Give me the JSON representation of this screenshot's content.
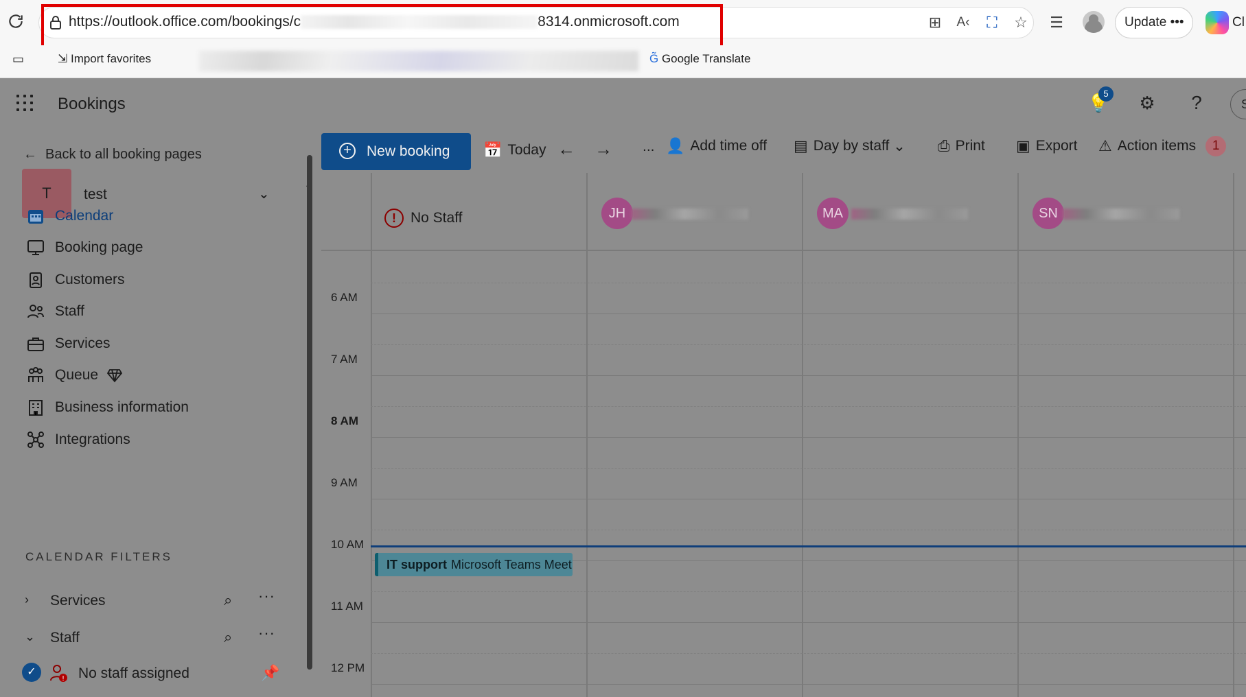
{
  "browser": {
    "url_prefix": "https://outlook.office.com/bookings/c",
    "url_suffix": "8314.onmicrosoft.com",
    "update_label": "Update",
    "update_more": "•••",
    "copilot_label": "Cl",
    "favorites": [
      {
        "label": "Import favorites"
      },
      {
        "label": "Google Translate"
      }
    ]
  },
  "app": {
    "title": "Bookings",
    "notification_count": "5",
    "user_initial": "S"
  },
  "sidebar": {
    "back_label": "Back to all booking pages",
    "booking_page": {
      "initial": "T",
      "name": "test"
    },
    "nav": [
      {
        "label": "Calendar",
        "icon": "calendar-icon",
        "active": true
      },
      {
        "label": "Booking page",
        "icon": "monitor-icon"
      },
      {
        "label": "Customers",
        "icon": "contact-card-icon"
      },
      {
        "label": "Staff",
        "icon": "people-icon"
      },
      {
        "label": "Services",
        "icon": "briefcase-icon"
      },
      {
        "label": "Queue",
        "icon": "queue-icon"
      },
      {
        "label": "Business information",
        "icon": "building-icon"
      },
      {
        "label": "Integrations",
        "icon": "integrations-icon"
      }
    ],
    "filters_header": "CALENDAR FILTERS",
    "filters": [
      {
        "label": "Services",
        "expanded": false
      },
      {
        "label": "Staff",
        "expanded": true
      }
    ],
    "staff_filter_item": "No staff assigned"
  },
  "toolbar": {
    "new_booking": "New booking",
    "today": "Today",
    "more": "...",
    "add_time_off": "Add time off",
    "view": "Day by staff",
    "print": "Print",
    "export": "Export",
    "action_items": "Action items",
    "action_count": "1"
  },
  "calendar": {
    "no_staff_label": "No Staff",
    "staff": [
      {
        "initials": "JH"
      },
      {
        "initials": "MA"
      },
      {
        "initials": "SN"
      }
    ],
    "times": [
      "6 AM",
      "7 AM",
      "8 AM",
      "9 AM",
      "10 AM",
      "11 AM",
      "12 PM"
    ],
    "current_hour": "8 AM",
    "event": {
      "title": "IT support",
      "location": "Microsoft Teams Meet"
    }
  },
  "colors": {
    "accent": "#0f4c8a",
    "event": "#4d8796",
    "staff_avatar": "#a34b86",
    "highlight_box": "#e00000"
  }
}
